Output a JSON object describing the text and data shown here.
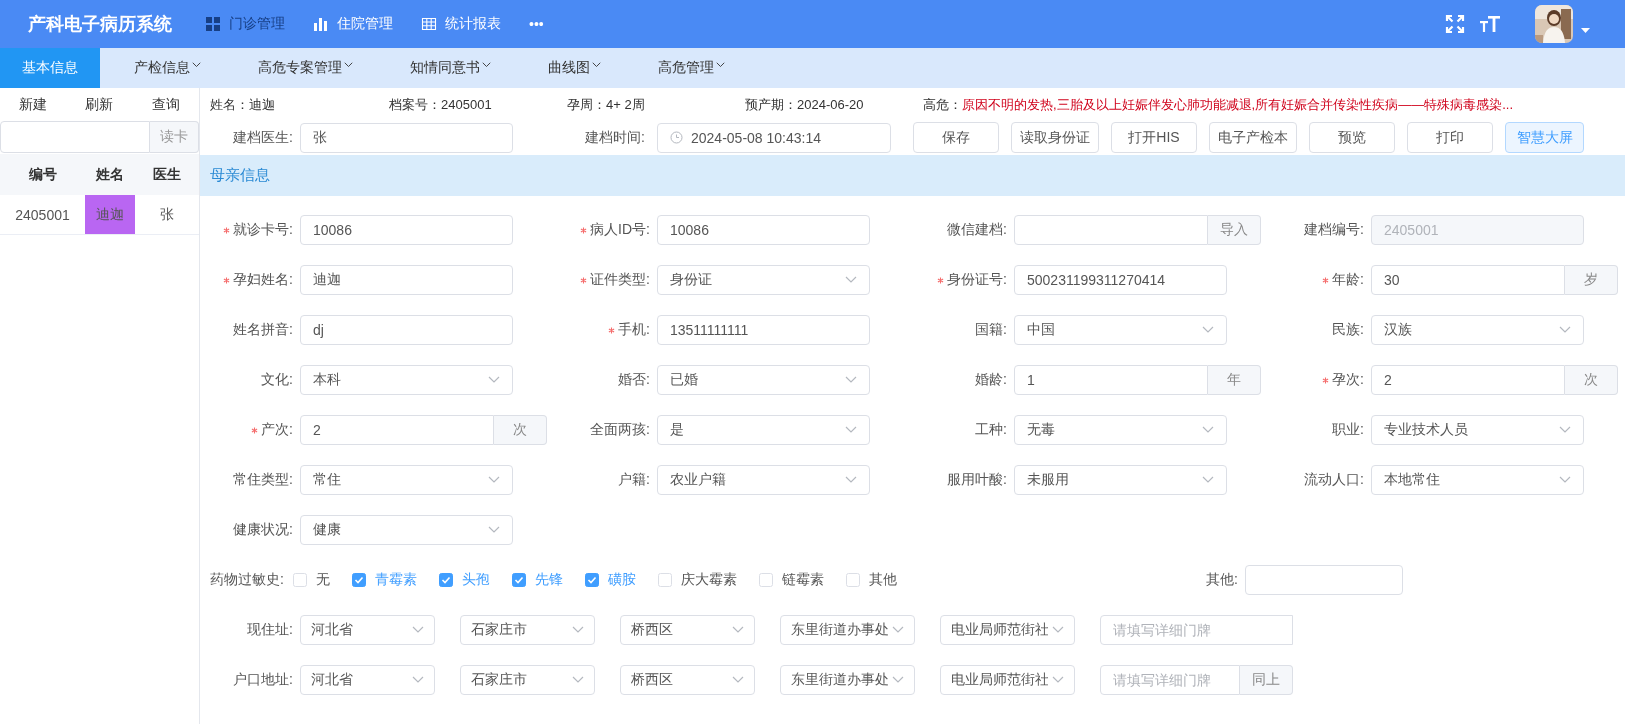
{
  "header": {
    "title": "产科电子病历系统",
    "nav": [
      {
        "label": "门诊管理",
        "selected": true
      },
      {
        "label": "住院管理",
        "selected": false
      },
      {
        "label": "统计报表",
        "selected": false
      },
      {
        "label": "•••",
        "selected": false
      }
    ]
  },
  "tabs": [
    {
      "label": "基本信息",
      "selected": true,
      "dropdown": false
    },
    {
      "label": "产检信息",
      "selected": false,
      "dropdown": true
    },
    {
      "label": "高危专案管理",
      "selected": false,
      "dropdown": true
    },
    {
      "label": "知情同意书",
      "selected": false,
      "dropdown": true
    },
    {
      "label": "曲线图",
      "selected": false,
      "dropdown": true
    },
    {
      "label": "高危管理",
      "selected": false,
      "dropdown": true
    }
  ],
  "sidebar": {
    "actions": [
      "新建",
      "刷新",
      "查询"
    ],
    "read_button": "读卡",
    "table": {
      "columns": [
        "编号",
        "姓名",
        "医生"
      ],
      "rows": [
        {
          "cells": [
            {
              "text": "2405001",
              "highlighted": false
            },
            {
              "text": "迪迦",
              "highlighted": true
            },
            {
              "text": "张",
              "highlighted": false
            }
          ]
        }
      ]
    }
  },
  "patient_bar": {
    "items": [
      "姓名：迪迦",
      "档案号：2405001",
      "孕周：4+ 2周",
      "预产期：2024-06-20"
    ],
    "risk": {
      "label": "高危：",
      "text": "原因不明的发热,三胎及以上妊娠伴发心肺功能减退,所有妊娠合并传染性疾病——特殊病毒感染..."
    }
  },
  "toolbar": {
    "doctor": {
      "label": "建档医生:",
      "value": "张"
    },
    "time": {
      "label": "建档时间:",
      "value": "2024-05-08 10:43:14"
    },
    "buttons": [
      {
        "label": "保存",
        "primary": false
      },
      {
        "label": "读取身份证",
        "primary": false
      },
      {
        "label": "打开HIS",
        "primary": false
      },
      {
        "label": "电子产检本",
        "primary": false
      },
      {
        "label": "预览",
        "primary": false
      },
      {
        "label": "打印",
        "primary": false
      },
      {
        "label": "智慧大屏",
        "primary": true
      }
    ]
  },
  "section": {
    "title": "母亲信息"
  },
  "form_rows": [
    [
      {
        "label": "就诊卡号:",
        "required": true,
        "kind": "text",
        "value": "10086"
      },
      {
        "label": "病人ID号:",
        "required": true,
        "kind": "text",
        "value": "10086"
      },
      {
        "label": "微信建档:",
        "required": false,
        "kind": "addon",
        "addon": "导入"
      },
      {
        "label": "建档编号:",
        "required": false,
        "kind": "disabled",
        "value": "2405001"
      }
    ],
    [
      {
        "label": "孕妇姓名:",
        "required": true,
        "kind": "text",
        "value": "迪迦"
      },
      {
        "label": "证件类型:",
        "required": true,
        "kind": "select",
        "value": "身份证"
      },
      {
        "label": "身份证号:",
        "required": true,
        "kind": "text",
        "value": "500231199311270414"
      },
      {
        "label": "年龄:",
        "required": true,
        "kind": "addon",
        "value": "30",
        "addon": "岁"
      }
    ],
    [
      {
        "label": "姓名拼音:",
        "required": false,
        "kind": "text",
        "value": "dj"
      },
      {
        "label": "手机:",
        "required": true,
        "kind": "text",
        "value": "13511111111"
      },
      {
        "label": "国籍:",
        "required": false,
        "kind": "select",
        "value": "中国"
      },
      {
        "label": "民族:",
        "required": false,
        "kind": "select",
        "value": "汉族"
      }
    ],
    [
      {
        "label": "文化:",
        "required": false,
        "kind": "select",
        "value": "本科"
      },
      {
        "label": "婚否:",
        "required": false,
        "kind": "select",
        "value": "已婚"
      },
      {
        "label": "婚龄:",
        "required": false,
        "kind": "addon",
        "value": "1",
        "addon": "年"
      },
      {
        "label": "孕次:",
        "required": true,
        "kind": "addon",
        "value": "2",
        "addon": "次"
      }
    ],
    [
      {
        "label": "产次:",
        "required": true,
        "kind": "addon",
        "value": "2",
        "addon": "次"
      },
      {
        "label": "全面两孩:",
        "required": false,
        "kind": "select",
        "value": "是"
      },
      {
        "label": "工种:",
        "required": false,
        "kind": "select",
        "value": "无毒"
      },
      {
        "label": "职业:",
        "required": false,
        "kind": "select",
        "value": "专业技术人员"
      }
    ],
    [
      {
        "label": "常住类型:",
        "required": false,
        "kind": "select",
        "value": "常住"
      },
      {
        "label": "户籍:",
        "required": false,
        "kind": "select",
        "value": "农业户籍"
      },
      {
        "label": "服用叶酸:",
        "required": false,
        "kind": "select",
        "value": "未服用"
      },
      {
        "label": "流动人口:",
        "required": false,
        "kind": "select",
        "value": "本地常住"
      }
    ],
    [
      {
        "label": "健康状况:",
        "required": false,
        "kind": "select",
        "value": "健康"
      }
    ]
  ],
  "allergies": {
    "label": "药物过敏史:",
    "options": [
      {
        "label": "无",
        "checked": false
      },
      {
        "label": "青霉素",
        "checked": true
      },
      {
        "label": "头孢",
        "checked": true
      },
      {
        "label": "先锋",
        "checked": true
      },
      {
        "label": "磺胺",
        "checked": true
      },
      {
        "label": "庆大霉素",
        "checked": false
      },
      {
        "label": "链霉素",
        "checked": false
      },
      {
        "label": "其他",
        "checked": false
      }
    ],
    "other": {
      "label": "其他:"
    }
  },
  "addresses": [
    {
      "label": "现住址:",
      "parts": [
        "河北省",
        "石家庄市",
        "桥西区",
        "东里街道办事处",
        "电业局师范街社"
      ],
      "detail_placeholder": "请填写详细门牌"
    },
    {
      "label": "户口地址:",
      "parts": [
        "河北省",
        "石家庄市",
        "桥西区",
        "东里街道办事处",
        "电业局师范街社"
      ],
      "detail_placeholder": "请填写详细门牌",
      "button": "同上"
    }
  ]
}
